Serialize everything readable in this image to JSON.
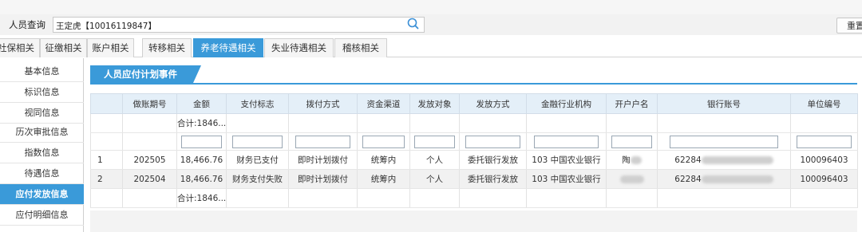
{
  "query": {
    "label": "人员查询",
    "value": "王定虎【10016119847】"
  },
  "toolbar": {
    "reset_label": "重置"
  },
  "tabs": [
    {
      "label": "社保相关",
      "active": false
    },
    {
      "label": "征缴相关",
      "active": false
    },
    {
      "label": "账户相关",
      "active": false
    },
    {
      "label": "转移相关",
      "active": false
    },
    {
      "label": "养老待遇相关",
      "active": true
    },
    {
      "label": "失业待遇相关",
      "active": false
    },
    {
      "label": "稽核相关",
      "active": false
    }
  ],
  "sidebar": {
    "items": [
      {
        "label": "基本信息"
      },
      {
        "label": "标识信息"
      },
      {
        "label": "视同信息"
      },
      {
        "label": "历次审批信息"
      },
      {
        "label": "指数信息"
      },
      {
        "label": "待遇信息"
      },
      {
        "label": "应付发放信息",
        "active": true
      },
      {
        "label": "应付明细信息"
      }
    ]
  },
  "panel": {
    "title": "人员应付计划事件"
  },
  "table": {
    "headers": [
      "",
      "做账期号",
      "金额",
      "支付标志",
      "拨付方式",
      "资金渠道",
      "发放对象",
      "发放方式",
      "金融行业机构",
      "开户户名",
      "银行账号",
      "单位编号"
    ],
    "top_sum": "合计:1846...",
    "rows": [
      {
        "idx": "1",
        "period": "202505",
        "amount": "18,466.76",
        "pay_flag": "财务已支付",
        "method": "即时计划拨付",
        "channel": "统筹内",
        "target": "个人",
        "issue_way": "委托银行发放",
        "bank": "103 中国农业银行",
        "account_name": "陶",
        "account_no": "62284",
        "unit_no": "100096403"
      },
      {
        "idx": "2",
        "period": "202504",
        "amount": "18,466.76",
        "pay_flag": "财务支付失败",
        "method": "即时计划拨付",
        "channel": "统筹内",
        "target": "个人",
        "issue_way": "委托银行发放",
        "bank": "103 中国农业银行",
        "account_name": "",
        "account_no": "62284",
        "unit_no": "100096403"
      }
    ],
    "bottom_sum": "合计:1846..."
  },
  "colors": {
    "accent": "#3a9ad9",
    "header_bg": "#e4eff8"
  }
}
